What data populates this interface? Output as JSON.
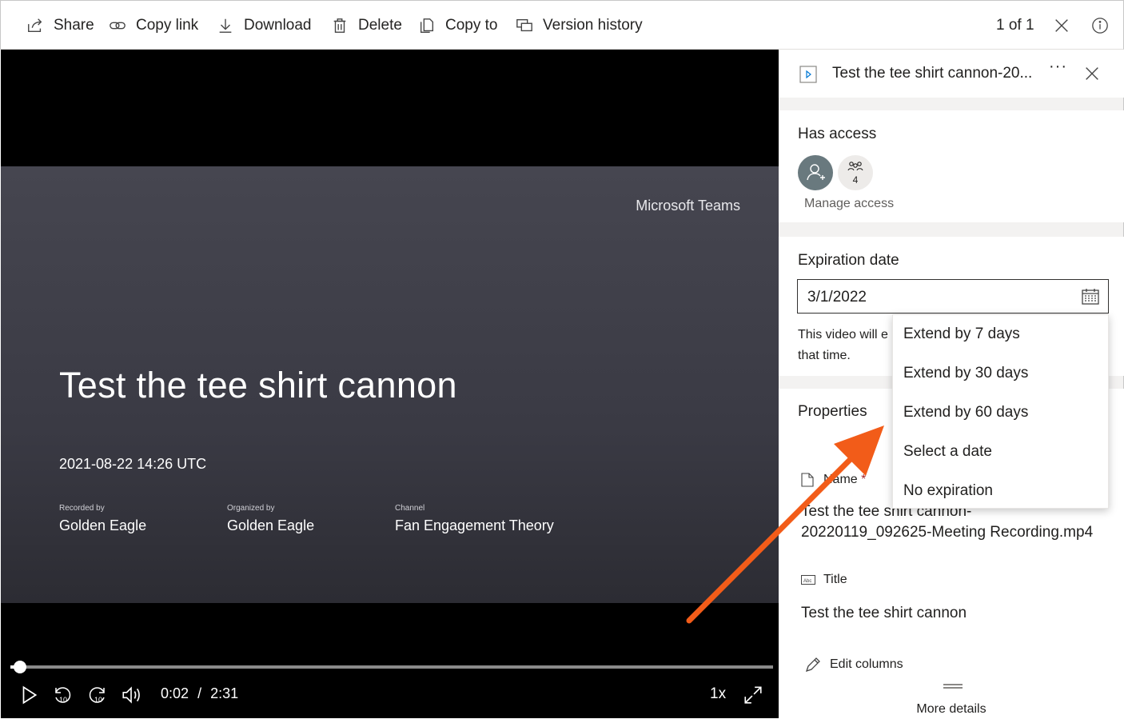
{
  "toolbar": {
    "share": "Share",
    "copy_link": "Copy link",
    "download": "Download",
    "delete": "Delete",
    "copy_to": "Copy to",
    "version_history": "Version history",
    "count": "1 of 1"
  },
  "video": {
    "brand": "Microsoft Teams",
    "title": "Test the tee shirt cannon",
    "date": "2021-08-22 14:26 UTC",
    "recorded_by_label": "Recorded by",
    "recorded_by": "Golden Eagle",
    "organized_by_label": "Organized by",
    "organized_by": "Golden Eagle",
    "channel_label": "Channel",
    "channel": "Fan Engagement Theory",
    "current_time": "0:02",
    "separator": "/",
    "duration": "2:31",
    "speed": "1x",
    "progress_fraction": 0.013,
    "skip_back": "10",
    "skip_forward": "10"
  },
  "panel": {
    "file_name": "Test the tee shirt cannon-20...",
    "more": "···",
    "has_access": {
      "heading": "Has access",
      "group_count": "4",
      "manage_access": "Manage access"
    },
    "expiration": {
      "heading": "Expiration date",
      "value": "3/1/2022",
      "help_line1": "This video will e",
      "help_line2": "that time."
    },
    "properties": {
      "heading": "Properties",
      "name_label": "Name",
      "required_mark": "*",
      "name_line1": "Test the tee shirt cannon-",
      "name_line2": "20220119_092625-Meeting Recording.mp4",
      "title_label": "Title",
      "title_value": "Test the tee shirt cannon",
      "edit_columns": "Edit columns",
      "more_details": "More details"
    }
  },
  "dropdown": {
    "items": [
      "Extend by 7 days",
      "Extend by 30 days",
      "Extend by 60 days",
      "Select a date",
      "No expiration"
    ]
  },
  "colors": {
    "annotation_arrow": "#f25c19",
    "avatar_grey": "#69797e"
  }
}
